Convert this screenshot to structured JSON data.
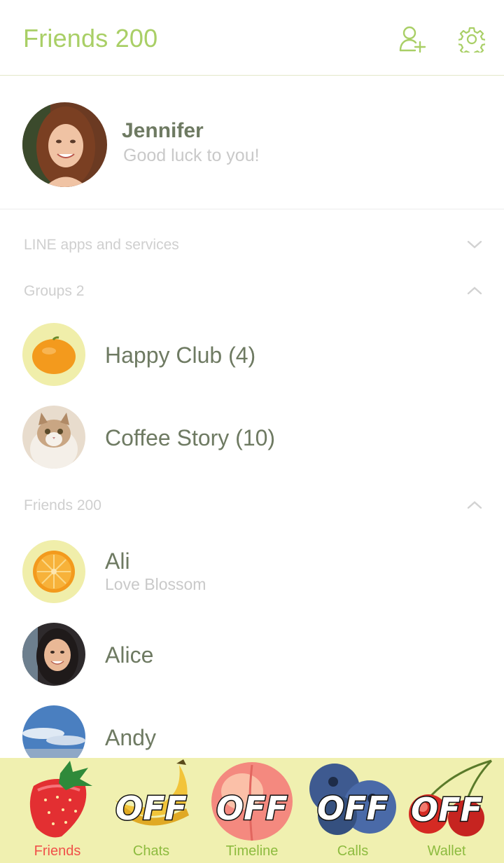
{
  "header": {
    "title": "Friends 200",
    "add_friend_icon": "add-friend-icon",
    "settings_icon": "gear-icon",
    "accent_color": "#a9cf66"
  },
  "profile": {
    "name": "Jennifer",
    "status": "Good luck to you!"
  },
  "sections": {
    "line_apps": {
      "label": "LINE apps and services",
      "expanded": false
    },
    "groups": {
      "label": "Groups 2",
      "expanded": true
    },
    "friends": {
      "label": "Friends 200",
      "expanded": true
    }
  },
  "groups": [
    {
      "name": "Happy Club (4)",
      "avatar": "tangerine"
    },
    {
      "name": "Coffee Story (10)",
      "avatar": "cat"
    }
  ],
  "friends": [
    {
      "name": "Ali",
      "status": "Love Blossom",
      "avatar": "orange-slice"
    },
    {
      "name": "Alice",
      "status": "",
      "avatar": "portrait"
    },
    {
      "name": "Andy",
      "status": "",
      "avatar": "sky"
    }
  ],
  "tabs": [
    {
      "label": "Friends",
      "art": "strawberry",
      "badge": "",
      "active": true
    },
    {
      "label": "Chats",
      "art": "banana",
      "badge": "OFF",
      "active": false
    },
    {
      "label": "Timeline",
      "art": "peach",
      "badge": "OFF",
      "active": false
    },
    {
      "label": "Calls",
      "art": "blueberry",
      "badge": "OFF",
      "active": false
    },
    {
      "label": "Wallet",
      "art": "cherry",
      "badge": "OFF",
      "active": false
    }
  ]
}
